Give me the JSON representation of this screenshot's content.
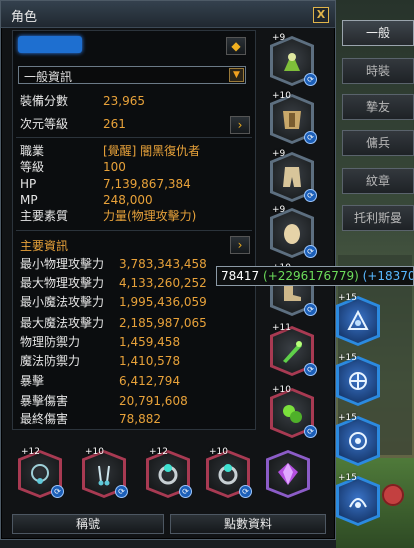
{
  "window": {
    "title": "角色",
    "close_label": "X"
  },
  "info": {
    "dropdown_label": "一般資訊",
    "rows_top": [
      {
        "label": "裝備分數",
        "value": "23,965"
      },
      {
        "label": "次元等級",
        "value": "261"
      }
    ],
    "rows_profile": [
      {
        "label": "職業",
        "value": "[覺醒] 闇黑復仇者"
      },
      {
        "label": "等級",
        "value": "100"
      },
      {
        "label": "HP",
        "value": "7,139,867,384"
      },
      {
        "label": "MP",
        "value": "248,000"
      },
      {
        "label": "主要素質",
        "value": "力量(物理攻擊力)"
      }
    ],
    "section_title": "主要資訊",
    "rows_stats": [
      {
        "label": "最小物理攻擊力",
        "value": "3,783,343,458"
      },
      {
        "label": "最大物理攻擊力",
        "value": "4,133,260,252"
      },
      {
        "label": "最小魔法攻擊力",
        "value": "1,995,436,059"
      },
      {
        "label": "最大魔法攻擊力",
        "value": "2,185,987,065"
      },
      {
        "label": "物理防禦力",
        "value": "1,459,458"
      },
      {
        "label": "魔法防禦力",
        "value": "1,410,578"
      },
      {
        "label": "暴擊",
        "value": "6,412,794"
      },
      {
        "label": "暴擊傷害",
        "value": "20,791,608"
      },
      {
        "label": "最終傷害",
        "value": "78,882"
      }
    ]
  },
  "equip_slots": [
    {
      "level": "+9",
      "badge": "on"
    },
    {
      "level": "+10"
    },
    {
      "level": "+9"
    },
    {
      "level": "+9"
    },
    {
      "level": "+10"
    },
    {
      "level": "+11"
    },
    {
      "level": "+10"
    }
  ],
  "bottom_slots": [
    {
      "level": "+12"
    },
    {
      "level": "+10"
    },
    {
      "level": "+12"
    },
    {
      "level": "+10"
    },
    {
      "level": ""
    }
  ],
  "skill_slots": [
    {
      "level": "+15"
    },
    {
      "level": "+15"
    },
    {
      "level": "+15"
    },
    {
      "level": "+15"
    }
  ],
  "buttons": {
    "title_button": "稱號",
    "details_button": "點數資料"
  },
  "side_tabs": [
    "一般",
    "時裝",
    "摯友",
    "傭兵",
    "紋章",
    "托利斯曼"
  ],
  "tooltip": {
    "base": "78417",
    "green": "(+2296176779)",
    "blue": "(+183700"
  },
  "colors": {
    "accent": "#e8a23a",
    "frame_red": "#a83a52",
    "frame_blue": "#2b8ae0",
    "frame_purple": "#8b5cc7"
  }
}
